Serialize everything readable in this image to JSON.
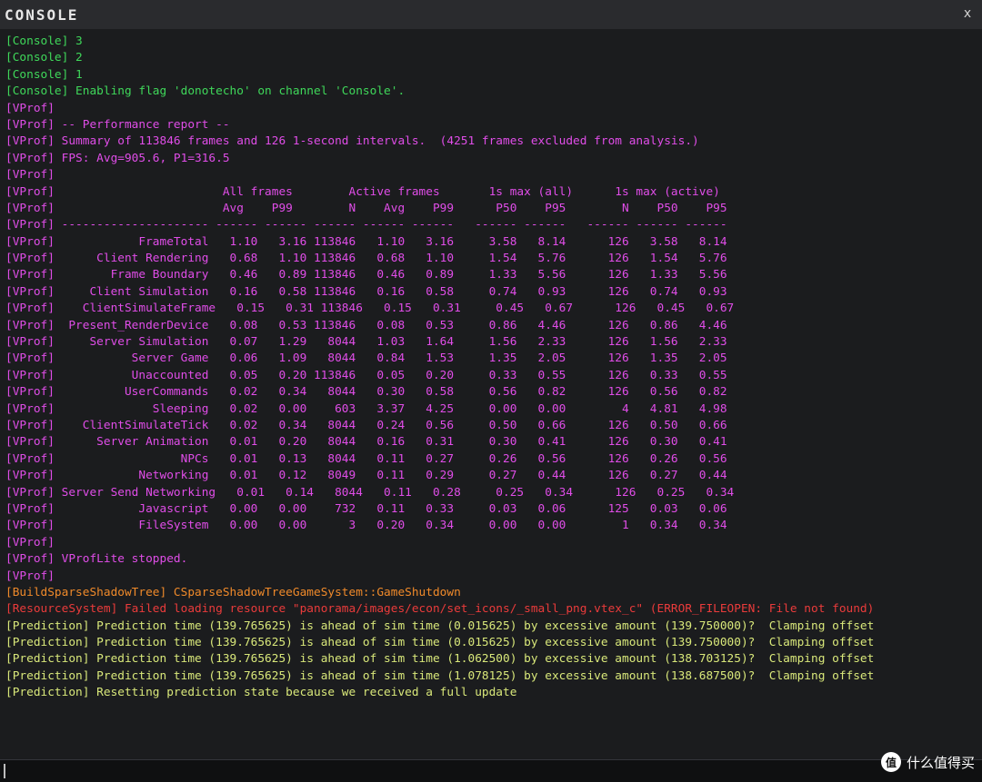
{
  "window": {
    "title": "CONSOLE",
    "close_label": "x"
  },
  "colors": {
    "green": "#3fd85a",
    "magenta": "#e04de8",
    "orange": "#f08a2a",
    "red": "#ea3b3b",
    "yellow": "#d9e87a"
  },
  "log": [
    {
      "text": "[Console] 3",
      "color": "green"
    },
    {
      "text": "[Console] 2",
      "color": "green"
    },
    {
      "text": "[Console] 1",
      "color": "green"
    },
    {
      "text": "[Console] Enabling flag 'donotecho' on channel 'Console'.",
      "color": "green"
    },
    {
      "text": "[VProf]",
      "color": "magenta"
    },
    {
      "text": "[VProf] -- Performance report --",
      "color": "magenta"
    },
    {
      "text": "[VProf] Summary of 113846 frames and 126 1-second intervals.  (4251 frames excluded from analysis.)",
      "color": "magenta"
    },
    {
      "text": "[VProf] FPS: Avg=905.6, P1=316.5",
      "color": "magenta"
    },
    {
      "text": "[VProf]",
      "color": "magenta"
    },
    {
      "text": "[VProf]                        All frames        Active frames       1s max (all)      1s max (active)",
      "color": "magenta"
    },
    {
      "text": "[VProf]                        Avg    P99        N    Avg    P99      P50    P95        N    P50    P95",
      "color": "magenta"
    },
    {
      "text": "[VProf] --------------------- ------ ------ ------ ------ ------   ------ ------   ------ ------ ------",
      "color": "magenta"
    },
    {
      "text": "[VProf]            FrameTotal   1.10   3.16 113846   1.10   3.16     3.58   8.14      126   3.58   8.14",
      "color": "magenta"
    },
    {
      "text": "[VProf]      Client Rendering   0.68   1.10 113846   0.68   1.10     1.54   5.76      126   1.54   5.76",
      "color": "magenta"
    },
    {
      "text": "[VProf]        Frame Boundary   0.46   0.89 113846   0.46   0.89     1.33   5.56      126   1.33   5.56",
      "color": "magenta"
    },
    {
      "text": "[VProf]     Client Simulation   0.16   0.58 113846   0.16   0.58     0.74   0.93      126   0.74   0.93",
      "color": "magenta"
    },
    {
      "text": "[VProf]    ClientSimulateFrame   0.15   0.31 113846   0.15   0.31     0.45   0.67      126   0.45   0.67",
      "color": "magenta"
    },
    {
      "text": "[VProf]  Present_RenderDevice   0.08   0.53 113846   0.08   0.53     0.86   4.46      126   0.86   4.46",
      "color": "magenta"
    },
    {
      "text": "[VProf]     Server Simulation   0.07   1.29   8044   1.03   1.64     1.56   2.33      126   1.56   2.33",
      "color": "magenta"
    },
    {
      "text": "[VProf]           Server Game   0.06   1.09   8044   0.84   1.53     1.35   2.05      126   1.35   2.05",
      "color": "magenta"
    },
    {
      "text": "[VProf]           Unaccounted   0.05   0.20 113846   0.05   0.20     0.33   0.55      126   0.33   0.55",
      "color": "magenta"
    },
    {
      "text": "[VProf]          UserCommands   0.02   0.34   8044   0.30   0.58     0.56   0.82      126   0.56   0.82",
      "color": "magenta"
    },
    {
      "text": "[VProf]              Sleeping   0.02   0.00    603   3.37   4.25     0.00   0.00        4   4.81   4.98",
      "color": "magenta"
    },
    {
      "text": "[VProf]    ClientSimulateTick   0.02   0.34   8044   0.24   0.56     0.50   0.66      126   0.50   0.66",
      "color": "magenta"
    },
    {
      "text": "[VProf]      Server Animation   0.01   0.20   8044   0.16   0.31     0.30   0.41      126   0.30   0.41",
      "color": "magenta"
    },
    {
      "text": "[VProf]                  NPCs   0.01   0.13   8044   0.11   0.27     0.26   0.56      126   0.26   0.56",
      "color": "magenta"
    },
    {
      "text": "[VProf]            Networking   0.01   0.12   8049   0.11   0.29     0.27   0.44      126   0.27   0.44",
      "color": "magenta"
    },
    {
      "text": "[VProf] Server Send Networking   0.01   0.14   8044   0.11   0.28     0.25   0.34      126   0.25   0.34",
      "color": "magenta"
    },
    {
      "text": "[VProf]            Javascript   0.00   0.00    732   0.11   0.33     0.03   0.06      125   0.03   0.06",
      "color": "magenta"
    },
    {
      "text": "[VProf]            FileSystem   0.00   0.00      3   0.20   0.34     0.00   0.00        1   0.34   0.34",
      "color": "magenta"
    },
    {
      "text": "[VProf]",
      "color": "magenta"
    },
    {
      "text": "[VProf] VProfLite stopped.",
      "color": "magenta"
    },
    {
      "text": "[VProf]",
      "color": "magenta"
    },
    {
      "text": "[BuildSparseShadowTree] CSparseShadowTreeGameSystem::GameShutdown",
      "color": "orange"
    },
    {
      "text": "[ResourceSystem] Failed loading resource \"panorama/images/econ/set_icons/_small_png.vtex_c\" (ERROR_FILEOPEN: File not found)",
      "color": "red"
    },
    {
      "text": "[Prediction] Prediction time (139.765625) is ahead of sim time (0.015625) by excessive amount (139.750000)?  Clamping offset",
      "color": "yellow"
    },
    {
      "text": "[Prediction] Prediction time (139.765625) is ahead of sim time (0.015625) by excessive amount (139.750000)?  Clamping offset",
      "color": "yellow"
    },
    {
      "text": "[Prediction] Prediction time (139.765625) is ahead of sim time (1.062500) by excessive amount (138.703125)?  Clamping offset",
      "color": "yellow"
    },
    {
      "text": "[Prediction] Prediction time (139.765625) is ahead of sim time (1.078125) by excessive amount (138.687500)?  Clamping offset",
      "color": "yellow"
    },
    {
      "text": "[Prediction] Resetting prediction state because we received a full update",
      "color": "yellow"
    }
  ],
  "input": {
    "value": ""
  },
  "watermark": {
    "logo_text": "值",
    "text": "什么值得买"
  }
}
